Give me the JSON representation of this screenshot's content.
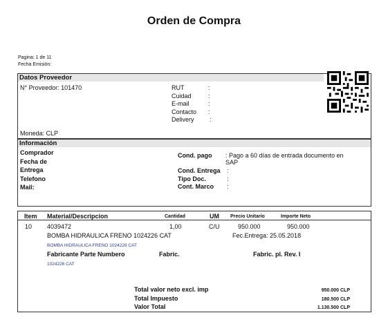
{
  "doc": {
    "title": "Orden de Compra",
    "page_label": "Pagina: 1 de 11",
    "date_label": "Fecha Emisión:"
  },
  "proveedor": {
    "header": "Datos Proveedor",
    "num": "N° Proveedor: 101470",
    "fields": [
      {
        "label": "RUT",
        "sep": ":"
      },
      {
        "label": "Cuidad",
        "sep": ":"
      },
      {
        "label": "E-mail",
        "sep": ":"
      },
      {
        "label": "Contacto",
        "sep": ":"
      },
      {
        "label": "Delivery",
        "sep": ":"
      }
    ],
    "moneda": "Moneda: CLP"
  },
  "info": {
    "header": "Información",
    "left": [
      "Comprador",
      "Fecha de",
      "Entrega",
      "Telefono",
      "Mail:"
    ],
    "cond_pago": "Cond. pago",
    "cond_pago_val": ": Pago a 60 días de entrada documento en",
    "cond_pago_val2": "SAP",
    "cond_entrega": "Cond. Entrega",
    "tipo_doc": "Tipo Doc.",
    "cond_marco": "Cont. Marco",
    "sep": ":"
  },
  "items": {
    "headers": {
      "item": "Item",
      "material": "Material/Descripcion",
      "cantidad": "Cantidad",
      "um": "UM",
      "precio": "Precio Unitario",
      "importe": "Importe Neto"
    },
    "row": {
      "item": "10",
      "code": "4039472",
      "cantidad": "1,00",
      "um": "C/U",
      "precio": "950.000",
      "importe": "950.000",
      "desc": "BOMBA HIDRAULICA FRENO 1024226 CAT",
      "entrega": "Fec.Entrega: 25.05.2018",
      "desc_blue": "BOMBA HIDRAULICA FRENO 1024226 CAT",
      "fab_parte": "Fabricante Parte Numbero",
      "fabric": "Fabric.",
      "fabric_rev": "Fabric. pl. Rev. I",
      "parte_blue": "1024226 CAT"
    }
  },
  "totals": [
    {
      "label": "Total valor neto excl. imp",
      "value": "950.000 CLP"
    },
    {
      "label": "Total Impuesto",
      "value": "180.500 CLP"
    },
    {
      "label": "Valor Total",
      "value": "1.130.500 CLP"
    }
  ]
}
